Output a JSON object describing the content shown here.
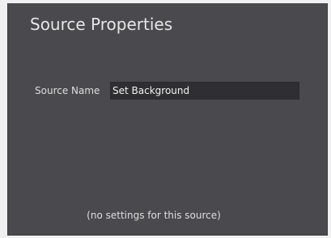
{
  "panel": {
    "title": "Source Properties"
  },
  "fields": {
    "source_name": {
      "label": "Source Name",
      "value": "Set Background"
    }
  },
  "empty_message": "(no settings for this source)"
}
